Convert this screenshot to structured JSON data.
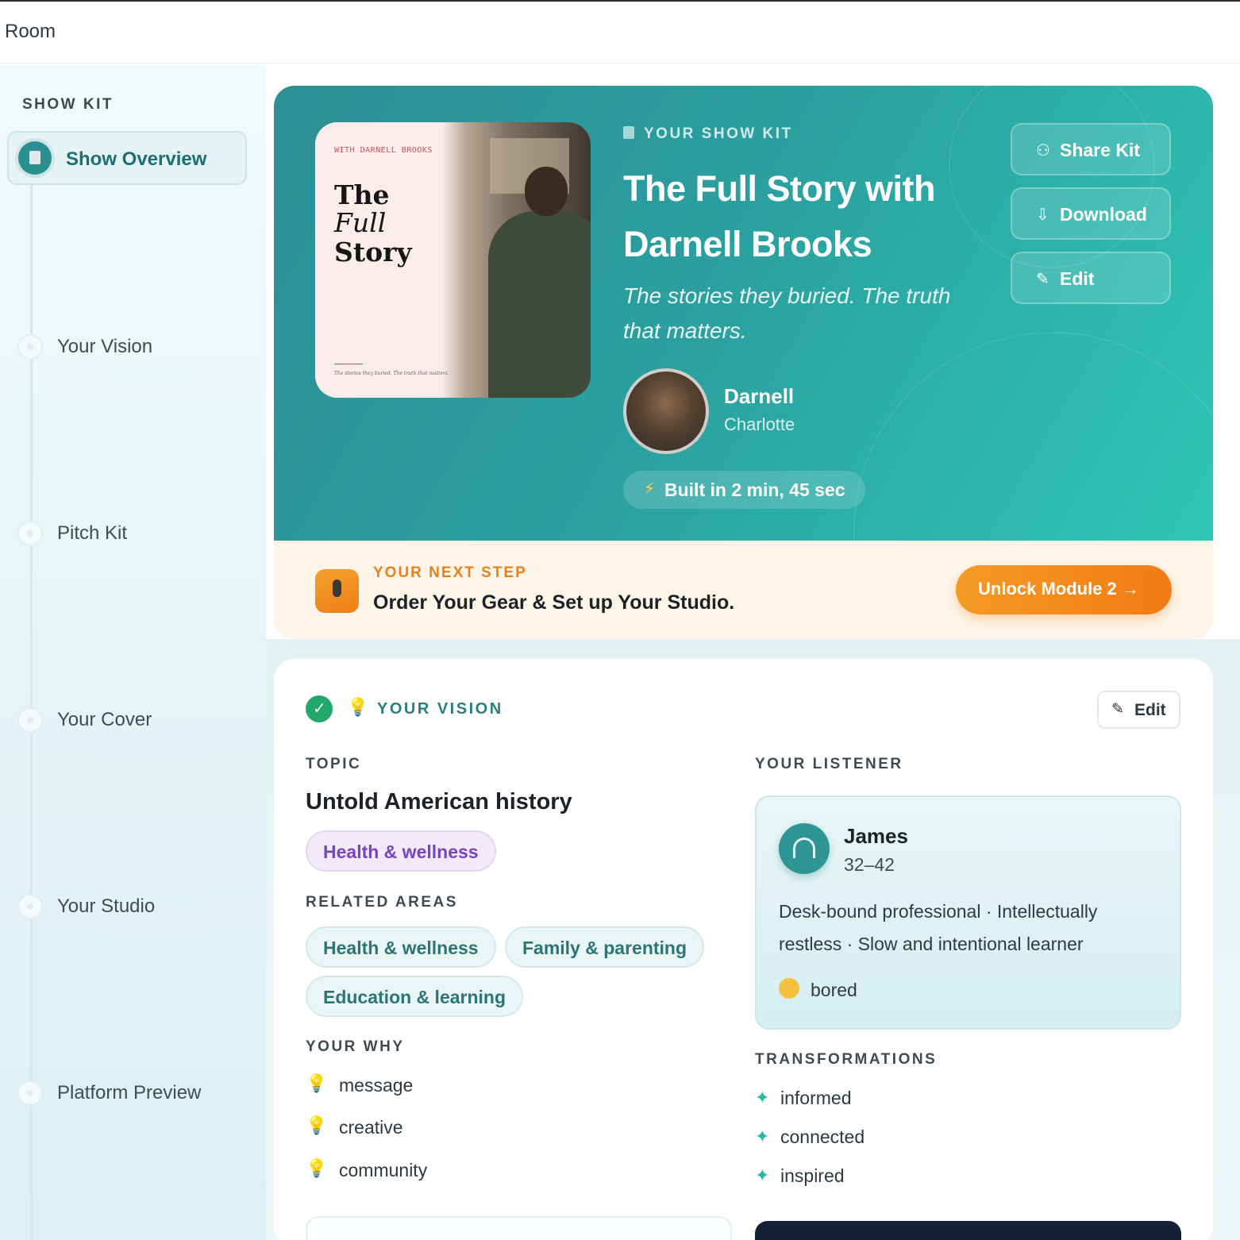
{
  "topbar": {
    "title": "Room"
  },
  "sidebar": {
    "section_title": "SHOW KIT",
    "items": [
      {
        "label": "Show Overview",
        "active": true
      },
      {
        "label": "Your Vision"
      },
      {
        "label": "Pitch Kit"
      },
      {
        "label": "Your Cover"
      },
      {
        "label": "Your Studio"
      },
      {
        "label": "Platform Preview"
      }
    ]
  },
  "hero": {
    "cover": {
      "with_line": "WITH DARNELL BROOKS",
      "title_lines": [
        "The",
        "Full",
        "Story"
      ],
      "tiny_tagline": "The stories they buried. The truth that matters."
    },
    "eyebrow": "YOUR SHOW KIT",
    "title": "The Full Story with Darnell Brooks",
    "tagline": "The stories they buried. The truth that matters.",
    "host": {
      "name": "Darnell",
      "city": "Charlotte"
    },
    "built": "Built in 2 min, 45 sec",
    "buttons": {
      "share": "Share Kit",
      "download": "Download",
      "edit": "Edit"
    }
  },
  "next_step": {
    "eyebrow": "YOUR NEXT STEP",
    "headline": "Order Your Gear & Set up Your Studio.",
    "button": "Unlock Module 2 →"
  },
  "vision": {
    "title": "YOUR VISION",
    "edit": "Edit",
    "topic_label": "TOPIC",
    "topic": "Untold American history",
    "topic_chip": "Health & wellness",
    "related_label": "RELATED AREAS",
    "related": [
      "Health & wellness",
      "Family & parenting",
      "Education & learning"
    ],
    "why_label": "YOUR WHY",
    "why": [
      "message",
      "creative",
      "community"
    ],
    "listener_label": "YOUR LISTENER",
    "listener": {
      "name": "James",
      "age": "32–42",
      "description": "Desk-bound professional · Intellectually restless · Slow and intentional learner",
      "mood": "bored"
    },
    "transformations_label": "TRANSFORMATIONS",
    "transformations": [
      "informed",
      "connected",
      "inspired"
    ]
  },
  "colors": {
    "accent_teal": "#2b9f9f",
    "orange": "#f27b14",
    "purple_chip": "#7a43bf",
    "success_green": "#22a86a"
  }
}
